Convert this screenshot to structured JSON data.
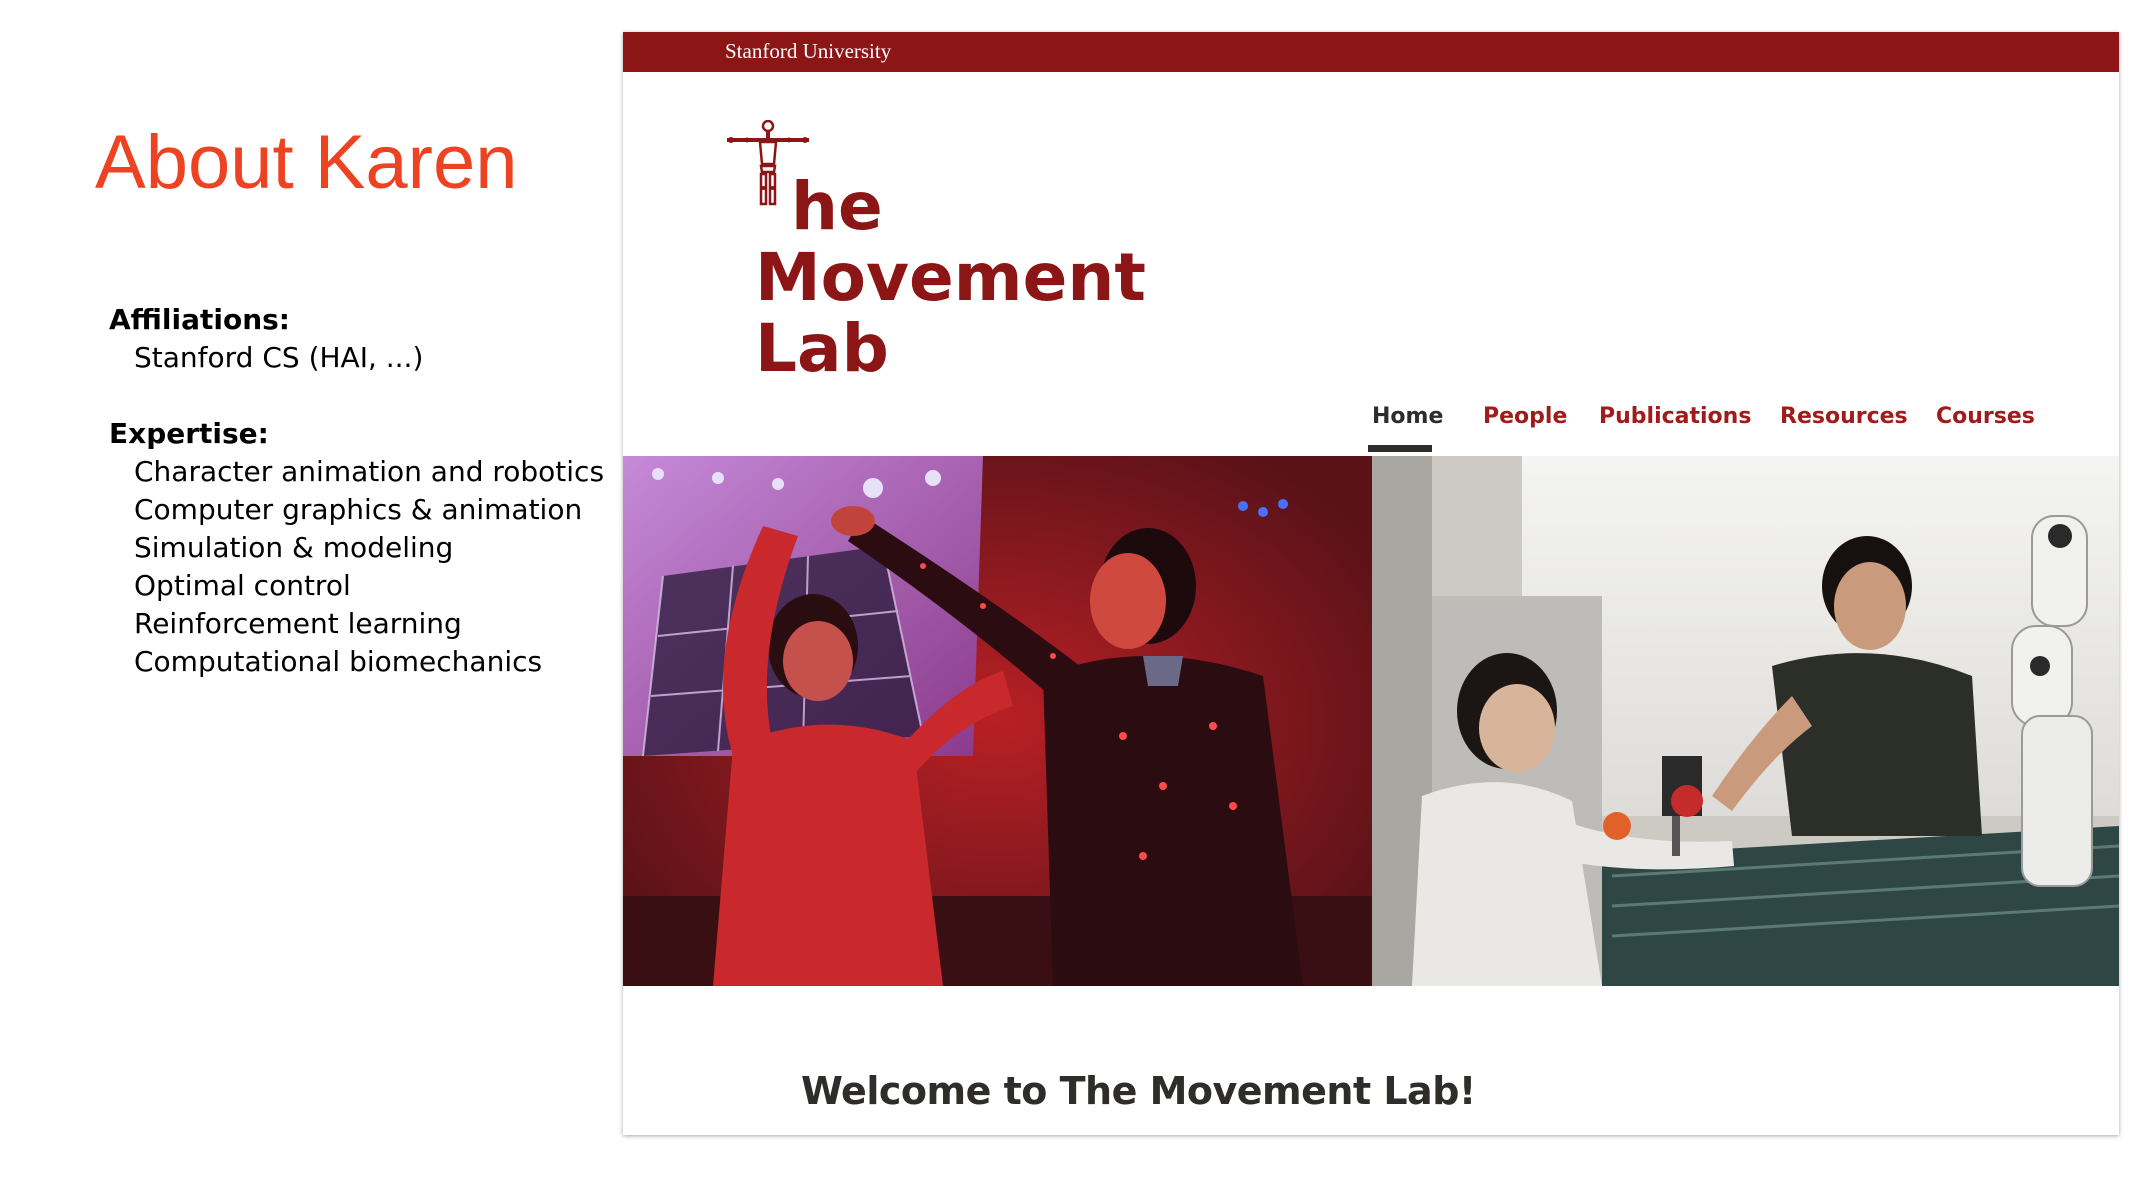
{
  "slide": {
    "title": "About Karen",
    "affiliations_heading": "Affiliations:",
    "affiliations": [
      "Stanford CS (HAI, ...)"
    ],
    "expertise_heading": "Expertise:",
    "expertise": [
      "Character animation and robotics",
      "Computer graphics & animation",
      "Simulation & modeling",
      "Optimal control",
      "Reinforcement learning",
      "Computational biomechanics"
    ],
    "title_color": "#ee4322"
  },
  "site": {
    "topbar_label": "Stanford University",
    "brand_color": "#8c1515",
    "logo": {
      "line1_rest": "he",
      "line2": "Movement",
      "line3": "Lab"
    },
    "nav": [
      {
        "label": "Home",
        "active": true
      },
      {
        "label": "People"
      },
      {
        "label": "Publications"
      },
      {
        "label": "Resources"
      },
      {
        "label": "Courses"
      }
    ],
    "welcome": "Welcome to The Movement Lab!"
  }
}
